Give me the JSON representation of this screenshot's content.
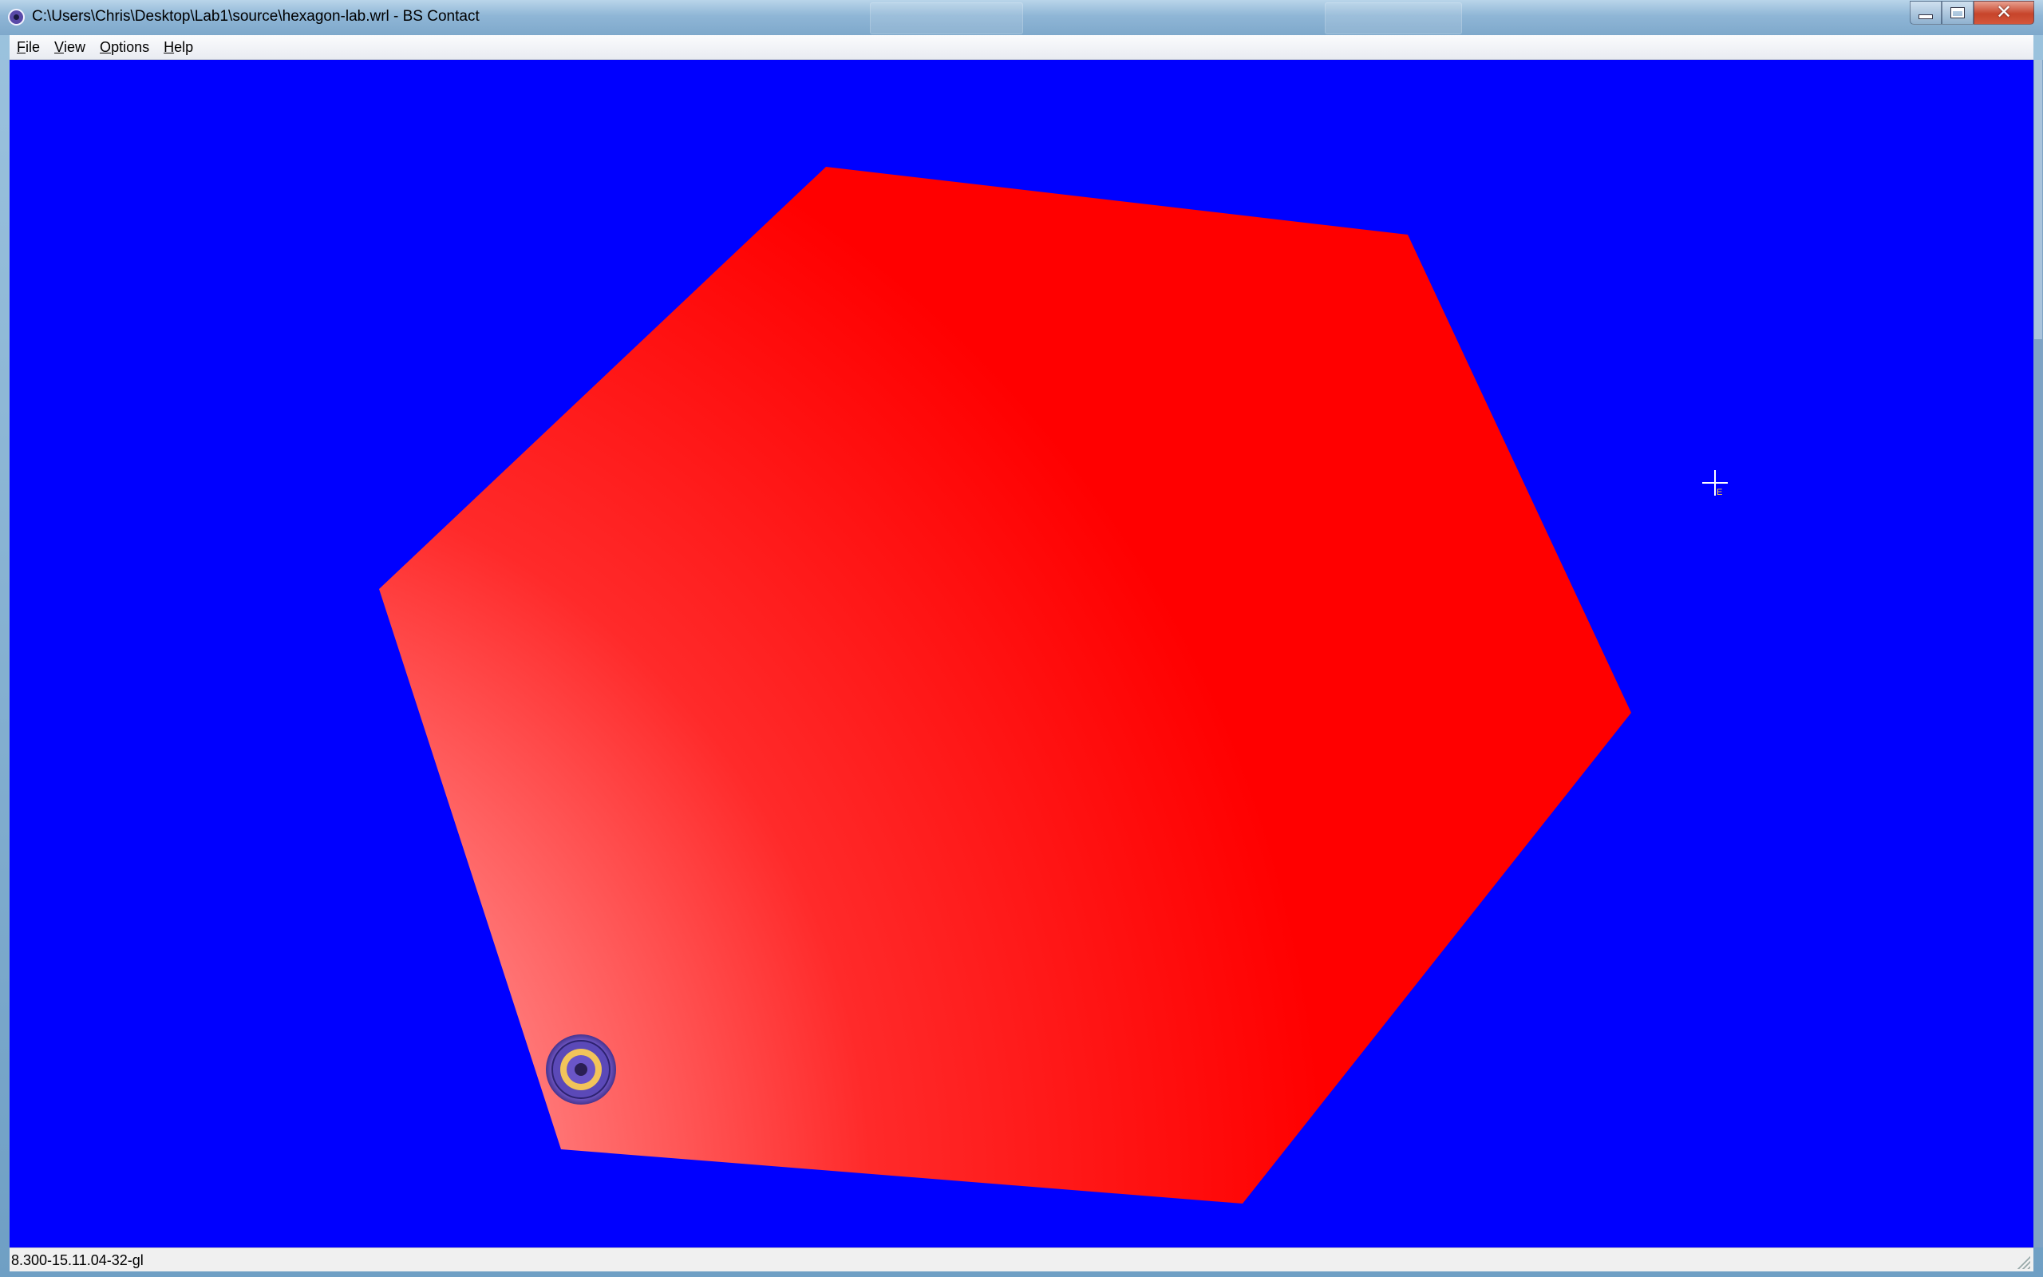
{
  "window": {
    "title": "C:\\Users\\Chris\\Desktop\\Lab1\\source\\hexagon-lab.wrl - BS Contact",
    "controls": {
      "minimize": "minimize",
      "maximize": "maximize",
      "close": "close"
    }
  },
  "menubar": {
    "items": [
      {
        "label": "File",
        "mnemonic": "F",
        "rest": "ile"
      },
      {
        "label": "View",
        "mnemonic": "V",
        "rest": "iew"
      },
      {
        "label": "Options",
        "mnemonic": "O",
        "rest": "ptions"
      },
      {
        "label": "Help",
        "mnemonic": "H",
        "rest": "elp"
      }
    ]
  },
  "scene": {
    "background_color": "#0000ff",
    "shape": "hexagon",
    "shape_color": "#ff0000",
    "highlight_color": "#ffa8a8",
    "navigation_icon": "viewpoint-target-icon",
    "cursor_icon": "crosshair-examine-cursor"
  },
  "cursor": {
    "label": "E"
  },
  "status": {
    "text": "8.300-15.11.04-32-gl"
  }
}
